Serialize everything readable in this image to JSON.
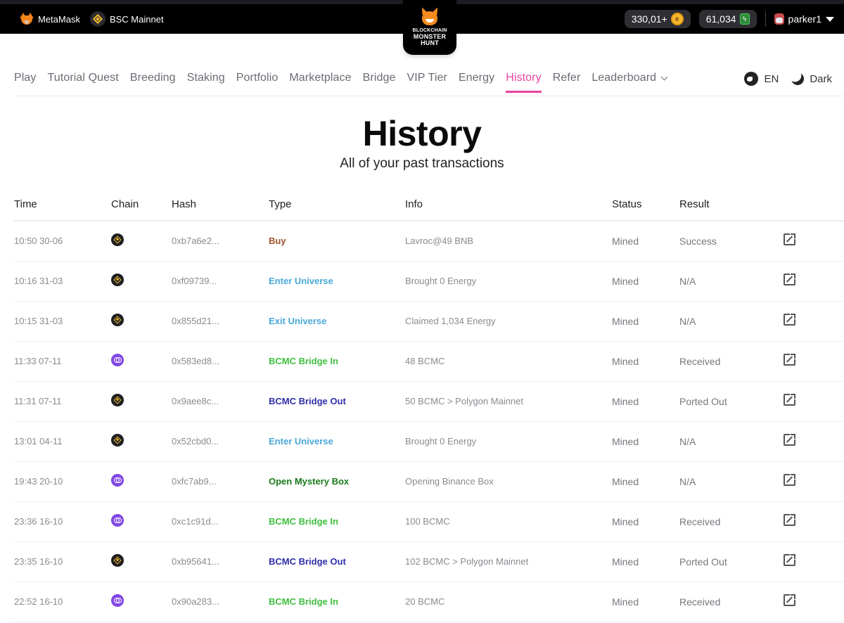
{
  "topbar": {
    "wallet": {
      "label": "MetaMask",
      "icon": "metamask-fox-icon"
    },
    "network": {
      "label": "BSC Mainnet",
      "icon": "bnb-icon"
    },
    "logo": {
      "line1": "BLOCKCHAIN",
      "line2": "MONSTER",
      "line3": "HUNT"
    },
    "balance_bcmc": {
      "value": "330,01+",
      "icon": "bcmc-coin-icon"
    },
    "balance_energy": {
      "value": "61,034",
      "icon": "energy-icon"
    },
    "user": {
      "name": "parker1",
      "icon": "avatar-icon"
    }
  },
  "nav": {
    "items": [
      {
        "label": "Play",
        "active": false
      },
      {
        "label": "Tutorial Quest",
        "active": false
      },
      {
        "label": "Breeding",
        "active": false
      },
      {
        "label": "Staking",
        "active": false
      },
      {
        "label": "Portfolio",
        "active": false
      },
      {
        "label": "Marketplace",
        "active": false
      },
      {
        "label": "Bridge",
        "active": false
      },
      {
        "label": "VIP Tier",
        "active": false
      },
      {
        "label": "Energy",
        "active": false
      },
      {
        "label": "History",
        "active": true
      },
      {
        "label": "Refer",
        "active": false
      },
      {
        "label": "Leaderboard",
        "active": false,
        "dropdown": true
      }
    ],
    "language": "EN",
    "theme": "Dark",
    "accent_color": "#e8459f"
  },
  "page": {
    "title": "History",
    "subtitle": "All of your past transactions"
  },
  "table": {
    "headers": [
      "Time",
      "Chain",
      "Hash",
      "Type",
      "Info",
      "Status",
      "Result",
      ""
    ],
    "rows": [
      {
        "time": "10:50 30-06",
        "chain": "bnb",
        "hash": "0xb7a6e2...",
        "type": "Buy",
        "type_color": "#a0522d",
        "info": "Lavroc@49 BNB",
        "status": "Mined",
        "result": "Success"
      },
      {
        "time": "10:16 31-03",
        "chain": "bnb",
        "hash": "0xf09739...",
        "type": "Enter Universe",
        "type_color": "#4aa8d8",
        "info": "Brought 0 Energy",
        "status": "Mined",
        "result": "N/A"
      },
      {
        "time": "10:15 31-03",
        "chain": "bnb",
        "hash": "0x855d21...",
        "type": "Exit Universe",
        "type_color": "#4aa8d8",
        "info": "Claimed 1,034 Energy",
        "status": "Mined",
        "result": "N/A"
      },
      {
        "time": "11:33 07-11",
        "chain": "polygon",
        "hash": "0x583ed8...",
        "type": "BCMC Bridge In",
        "type_color": "#3fbf3f",
        "info": "48 BCMC",
        "status": "Mined",
        "result": "Received"
      },
      {
        "time": "11:31 07-11",
        "chain": "bnb",
        "hash": "0x9aee8c...",
        "type": "BCMC Bridge Out",
        "type_color": "#2e2eaa",
        "info": "50 BCMC > Polygon Mainnet",
        "status": "Mined",
        "result": "Ported Out"
      },
      {
        "time": "13:01 04-11",
        "chain": "bnb",
        "hash": "0x52cbd0...",
        "type": "Enter Universe",
        "type_color": "#4aa8d8",
        "info": "Brought 0 Energy",
        "status": "Mined",
        "result": "N/A"
      },
      {
        "time": "19:43 20-10",
        "chain": "polygon",
        "hash": "0xfc7ab9...",
        "type": "Open Mystery Box",
        "type_color": "#1a7a1a",
        "info": "Opening Binance Box",
        "status": "Mined",
        "result": "N/A"
      },
      {
        "time": "23:36 16-10",
        "chain": "polygon",
        "hash": "0xc1c91d...",
        "type": "BCMC Bridge In",
        "type_color": "#3fbf3f",
        "info": "100 BCMC",
        "status": "Mined",
        "result": "Received"
      },
      {
        "time": "23:35 16-10",
        "chain": "bnb",
        "hash": "0xb95641...",
        "type": "BCMC Bridge Out",
        "type_color": "#2e2eaa",
        "info": "102 BCMC > Polygon Mainnet",
        "status": "Mined",
        "result": "Ported Out"
      },
      {
        "time": "22:52 16-10",
        "chain": "polygon",
        "hash": "0x90a283...",
        "type": "BCMC Bridge In",
        "type_color": "#3fbf3f",
        "info": "20 BCMC",
        "status": "Mined",
        "result": "Received"
      }
    ]
  }
}
